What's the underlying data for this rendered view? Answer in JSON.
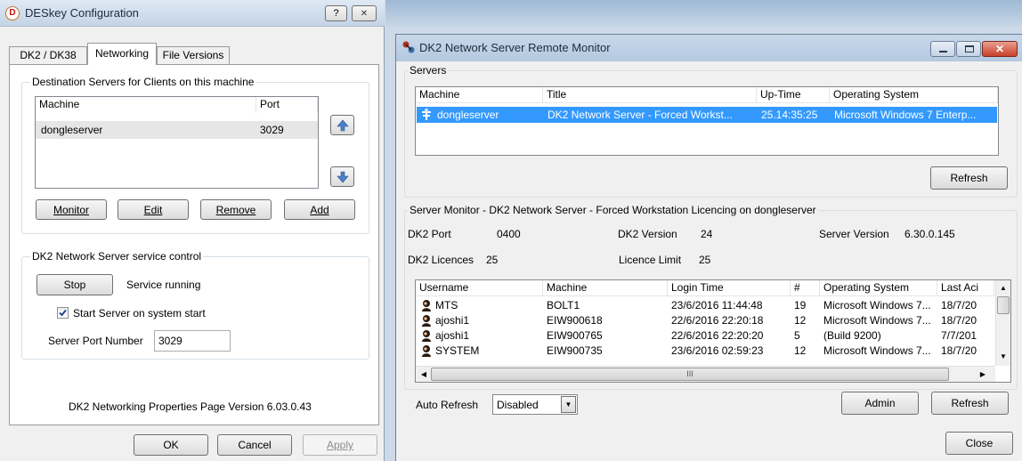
{
  "left_window": {
    "title": "DESkey Configuration",
    "help_button": "?",
    "close_button": "✕",
    "tabs": [
      {
        "label": "DK2 / DK38"
      },
      {
        "label": "Networking"
      },
      {
        "label": "File Versions"
      }
    ],
    "dest_group": {
      "title": "Destination Servers for Clients on this machine",
      "columns": [
        "Machine",
        "Port"
      ],
      "rows": [
        {
          "machine": "dongleserver",
          "port": "3029"
        }
      ],
      "buttons": {
        "monitor": "Monitor",
        "edit": "Edit",
        "remove": "Remove",
        "add": "Add"
      }
    },
    "service_group": {
      "title": "DK2 Network Server service control",
      "stop_button": "Stop",
      "status": "Service running",
      "checkbox_label": "Start Server on system start",
      "checkbox_checked": true,
      "port_label": "Server Port Number",
      "port_value": "3029"
    },
    "version_text": "DK2 Networking Properties Page Version 6.03.0.43",
    "footer": {
      "ok": "OK",
      "cancel": "Cancel",
      "apply": "Apply"
    }
  },
  "right_window": {
    "title": "DK2 Network Server Remote Monitor",
    "servers_group": {
      "title": "Servers",
      "columns": [
        "Machine",
        "Title",
        "Up-Time",
        "Operating System"
      ],
      "rows": [
        {
          "machine": "dongleserver",
          "title": "DK2 Network Server - Forced Workst...",
          "uptime": "25.14:35:25",
          "os": "Microsoft Windows 7 Enterp..."
        }
      ],
      "refresh": "Refresh"
    },
    "monitor_group": {
      "title": "Server Monitor - DK2 Network Server - Forced Workstation Licencing on dongleserver",
      "dk2_port_label": "DK2 Port",
      "dk2_port_value": "0400",
      "dk2_version_label": "DK2 Version",
      "dk2_version_value": "24",
      "server_version_label": "Server Version",
      "server_version_value": "6.30.0.145",
      "licences_label": "DK2 Licences",
      "licences_value": "25",
      "licence_limit_label": "Licence Limit",
      "licence_limit_value": "25",
      "columns": [
        "Username",
        "Machine",
        "Login Time",
        "#",
        "Operating System",
        "Last Aci"
      ],
      "rows": [
        {
          "user": "MTS",
          "machine": "BOLT1",
          "login": "23/6/2016 11:44:48",
          "num": "19",
          "os": "Microsoft Windows 7...",
          "last": "18/7/20"
        },
        {
          "user": "ajoshi1",
          "machine": "EIW900618",
          "login": "22/6/2016 22:20:18",
          "num": "12",
          "os": "Microsoft Windows 7...",
          "last": "18/7/20"
        },
        {
          "user": "ajoshi1",
          "machine": "EIW900765",
          "login": "22/6/2016 22:20:20",
          "num": "5",
          "os": "(Build 9200)",
          "last": "7/7/201"
        },
        {
          "user": "SYSTEM",
          "machine": "EIW900735",
          "login": "23/6/2016 02:59:23",
          "num": "12",
          "os": "Microsoft Windows 7...",
          "last": "18/7/20"
        }
      ],
      "hscroll_thumb_label": "III"
    },
    "auto_refresh_label": "Auto Refresh",
    "auto_refresh_value": "Disabled",
    "admin": "Admin",
    "refresh": "Refresh",
    "close": "Close"
  }
}
